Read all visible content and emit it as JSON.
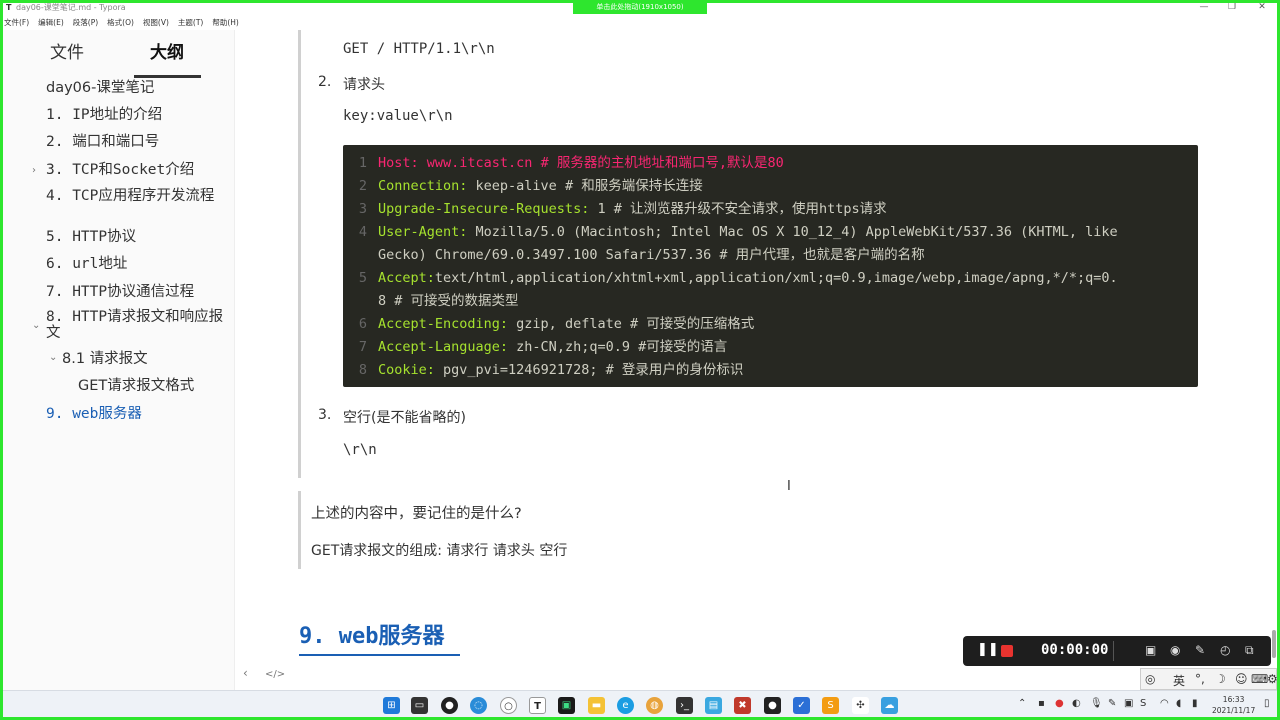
{
  "window": {
    "title": "day06-课堂笔记.md - Typora",
    "app_icon": "T",
    "capture_label": "单击此处拖动(1910x1050)",
    "controls": [
      "—",
      "❐",
      "✕"
    ]
  },
  "menu": [
    "文件(F)",
    "编辑(E)",
    "段落(P)",
    "格式(O)",
    "视图(V)",
    "主题(T)",
    "帮助(H)"
  ],
  "sidebar": {
    "tab_files": "文件",
    "tab_outline": "大纲",
    "items": [
      "day06-课堂笔记",
      "1. IP地址的介绍",
      "2. 端口和端口号",
      "3. TCP和Socket介绍",
      "4. TCP应用程序开发流程",
      "5. HTTP协议",
      "6. url地址",
      "7. HTTP协议通信过程",
      "8. HTTP请求报文和响应报文",
      "8.1 请求报文",
      "GET请求报文格式",
      "9. web服务器"
    ],
    "footer_left": "‹",
    "footer_code": "</>"
  },
  "content": {
    "request_line": "GET / HTTP/1.1\\r\\n",
    "item2_num": "2.",
    "item2_label": "请求头",
    "header_format": "key:value\\r\\n",
    "code_lines": [
      {
        "n": "1",
        "key": "Host: www.itcast.cn",
        "val": "",
        "comment": "  # 服务器的主机地址和端口号,默认是80"
      },
      {
        "n": "2",
        "key": "Connection:",
        "val": " keep-alive",
        "comment": " # 和服务端保持长连接"
      },
      {
        "n": "3",
        "key": "Upgrade-Insecure-Requests:",
        "val": " 1",
        "comment": " # 让浏览器升级不安全请求，使用https请求"
      },
      {
        "n": "4",
        "key": "User-Agent:",
        "val": " Mozilla/5.0 (Macintosh; Intel Mac OS X 10_12_4) AppleWebKit/537.36 (KHTML, like",
        "comment": ""
      },
      {
        "n": "",
        "key": "",
        "val": "Gecko) Chrome/69.0.3497.100 Safari/537.36",
        "comment": "  # 用户代理，也就是客户端的名称"
      },
      {
        "n": "5",
        "key": "Accept:",
        "val": "text/html,application/xhtml+xml,application/xml;q=0.9,image/webp,image/apng,*/*;q=0.",
        "comment": ""
      },
      {
        "n": "",
        "key": "",
        "val": "8",
        "comment": " # 可接受的数据类型"
      },
      {
        "n": "6",
        "key": "Accept-Encoding:",
        "val": " gzip, deflate",
        "comment": " # 可接受的压缩格式"
      },
      {
        "n": "7",
        "key": "Accept-Language:",
        "val": " zh-CN,zh;q=0.9",
        "comment": " #可接受的语言"
      },
      {
        "n": "8",
        "key": "Cookie:",
        "val": " pgv_pvi=1246921728;",
        "comment": " # 登录用户的身份标识"
      }
    ],
    "item3_num": "3.",
    "item3_label": "空行(是不能省略的)",
    "blank_line": "\\r\\n",
    "question": "上述的内容中，要记住的是什么?",
    "answer": "GET请求报文的组成:   请求行   请求头   空行",
    "heading9": "9. web服务器"
  },
  "recorder": {
    "timer": "00:00:00"
  },
  "ime": {
    "lang": "英"
  },
  "taskbar": {
    "clock_time": "16:33",
    "clock_date": "2021/11/17"
  }
}
